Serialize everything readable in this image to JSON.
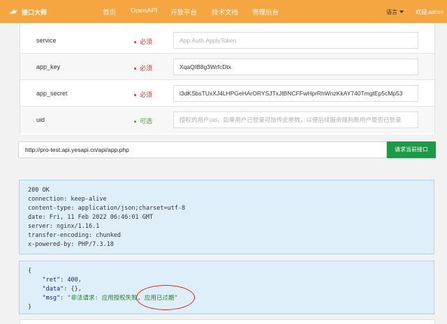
{
  "nav": {
    "logo_text": "接口大师",
    "links": [
      "首页",
      "OpenAPI",
      "开放平台",
      "技术文档",
      "管理后台"
    ],
    "language": "语言",
    "welcome": "欢迎,admin",
    "bg_color": "#f5a640"
  },
  "params": [
    {
      "name": "service",
      "required_label": "必须",
      "status_color": "#d9342b",
      "value": "",
      "placeholder": "App.Auth.ApplyToken"
    },
    {
      "name": "app_key",
      "required_label": "必须",
      "status_color": "#d9342b",
      "value": "XqaQIB8g3WrfcDtx",
      "placeholder": ""
    },
    {
      "name": "app_secret",
      "required_label": "必须",
      "status_color": "#d9342b",
      "value": "l3dKSbsTUxXJ4LHPGeHArORYSJTxJIBNCFFwHprRhWnzKkAY740TmgtEp5cMp53",
      "placeholder": ""
    },
    {
      "name": "uid",
      "required_label": "可选",
      "status_color": "#3aa63a",
      "value": "",
      "placeholder": "授权的用户uid，如果用户已登录可加传此参数，以便后续服务端判断用户是否已登录"
    }
  ],
  "request": {
    "url": "http://pro-test.api.yesapi.cn/api/app.php",
    "button_label": "请求当前接口",
    "button_color": "#1c9a47"
  },
  "response_headers": [
    "200 OK",
    "connection: keep-alive",
    "content-type: application/json;charset=utf-8",
    "date: Fri, 11 Feb 2022 06:46:01 GMT",
    "server: nginx/1.16.1",
    "transfer-encoding: chunked",
    "x-powered-by: PHP/7.3.18"
  ],
  "response_body": {
    "open": "{",
    "ret_key": "\"ret\"",
    "ret_value": "400",
    "data_key": "\"data\"",
    "data_value": "{}",
    "msg_key": "\"msg\"",
    "msg_value": "\"非法请求: 应用授权失败, 应用已过期\"",
    "close": "}"
  }
}
